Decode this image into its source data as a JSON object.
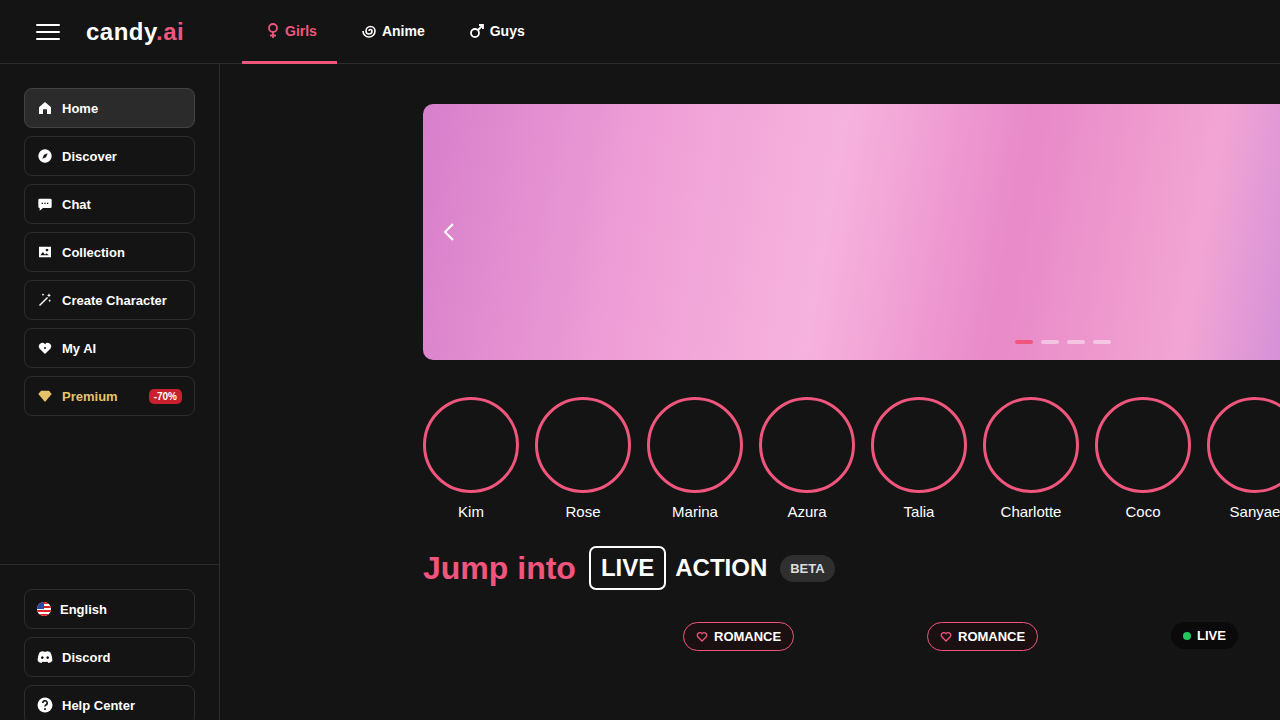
{
  "header": {
    "logo": {
      "main": "candy",
      "accent": ".ai"
    },
    "tabs": [
      {
        "label": "Girls",
        "selected": true
      },
      {
        "label": "Anime",
        "selected": false
      },
      {
        "label": "Guys",
        "selected": false
      }
    ]
  },
  "sidebar": {
    "items": [
      {
        "label": "Home",
        "selected": true,
        "kind": "link"
      },
      {
        "label": "Discover",
        "selected": false,
        "kind": "link"
      },
      {
        "label": "Chat",
        "selected": false,
        "kind": "link"
      },
      {
        "label": "Collection",
        "selected": false,
        "kind": "link"
      },
      {
        "label": "Create Character",
        "selected": false,
        "kind": "link"
      },
      {
        "label": "My AI",
        "selected": false,
        "kind": "link"
      },
      {
        "label": "Premium",
        "selected": false,
        "kind": "premium",
        "badge": "-70%"
      }
    ],
    "footer": [
      {
        "label": "English"
      },
      {
        "label": "Discord"
      },
      {
        "label": "Help Center"
      }
    ]
  },
  "banner": {
    "slides": [
      {
        "selected": true
      },
      {
        "selected": false
      },
      {
        "selected": false
      },
      {
        "selected": false
      }
    ]
  },
  "stories": [
    {
      "name": "Kim"
    },
    {
      "name": "Rose"
    },
    {
      "name": "Marina"
    },
    {
      "name": "Azura"
    },
    {
      "name": "Talia"
    },
    {
      "name": "Charlotte"
    },
    {
      "name": "Coco"
    },
    {
      "name": "Sanyae"
    }
  ],
  "section": {
    "title": "Jump into",
    "highlight": "LIVE",
    "rest": "ACTION",
    "badge": "BETA"
  },
  "cards": [
    {
      "tags": []
    },
    {
      "tags": [
        {
          "label": "ROMANCE",
          "kind": "romance"
        }
      ]
    },
    {
      "tags": [
        {
          "label": "ROMANCE",
          "kind": "romance"
        }
      ]
    },
    {
      "tags": [
        {
          "label": "LIVE",
          "kind": "live"
        }
      ]
    }
  ]
}
